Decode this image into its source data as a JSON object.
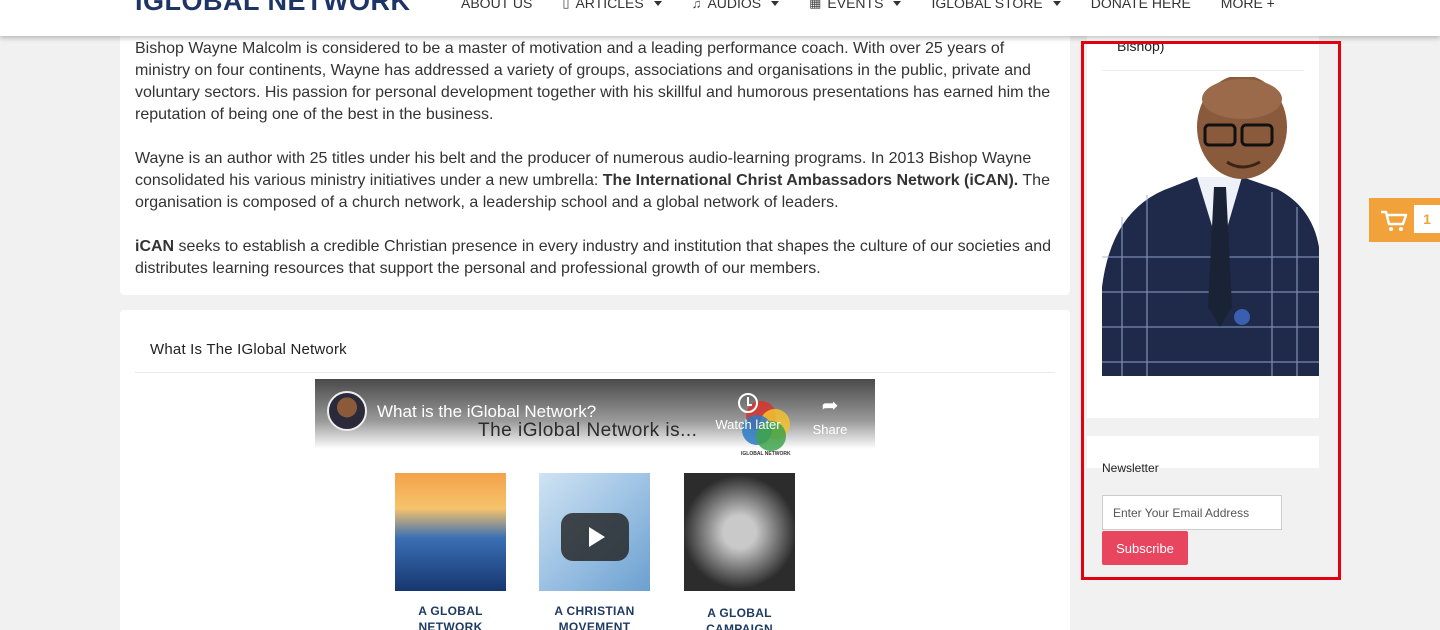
{
  "header": {
    "logo": "IGLOBAL NETWORK",
    "nav": [
      {
        "label": "ABOUT US",
        "icon": "",
        "dropdown": false
      },
      {
        "label": "ARTICLES",
        "icon": "bookmark-icon",
        "dropdown": true
      },
      {
        "label": "AUDIOS",
        "icon": "music-icon",
        "dropdown": true
      },
      {
        "label": "EVENTS",
        "icon": "calendar-icon",
        "dropdown": true
      },
      {
        "label": "IGLOBAL STORE",
        "icon": "",
        "dropdown": true
      },
      {
        "label": "DONATE HERE",
        "icon": "",
        "dropdown": false
      },
      {
        "label": "MORE +",
        "icon": "",
        "dropdown": false
      }
    ]
  },
  "bio": {
    "p1": "Bishop Wayne Malcolm is considered to be a master of motivation and a leading performance coach. With over 25 years of ministry on four continents, Wayne has addressed a variety of groups, associations and organisations in the public, private and voluntary sectors. His passion for personal development together with his skillful and humorous presentations has earned him the reputation of being one of the best in the business.",
    "p2_a": "Wayne is an author with 25 titles under his belt and the producer of numerous audio-learning programs. In 2013 Bishop Wayne consolidated his various ministry initiatives under a new umbrella:  ",
    "p2_b": "The International Christ Ambassadors Network (iCAN).",
    "p2_c": " The organisation is composed of a church network, a leadership school and a global network of leaders.",
    "p3_a": "iCAN",
    "p3_b": " seeks to establish a credible Christian presence in every industry and institution that shapes the culture of our societies and distributes learning resources that support the personal and professional growth of our members."
  },
  "video_section": {
    "title": "What Is The IGlobal Network",
    "video_title": "What is the iGlobal Network?",
    "video_subtitle": "The iGlobal Network is...",
    "watch_later": "Watch later",
    "share": "Share",
    "logo_caption": "IGLOBAL NETWORK",
    "tiles": [
      {
        "caption": "A GLOBAL NETWORK"
      },
      {
        "caption": "A CHRISTIAN MOVEMENT"
      },
      {
        "caption": "A GLOBAL CAMPAIGN"
      }
    ]
  },
  "sidebar": {
    "name_fragment": "Bishop)",
    "newsletter_label": "Newsletter",
    "email_placeholder": "Enter Your Email Address",
    "subscribe_label": "Subscribe"
  },
  "cart": {
    "count": "1"
  },
  "colors": {
    "accent": "#e8455f",
    "cart": "#f1a23a",
    "logo": "#1f3466",
    "highlight": "#e3000f"
  }
}
